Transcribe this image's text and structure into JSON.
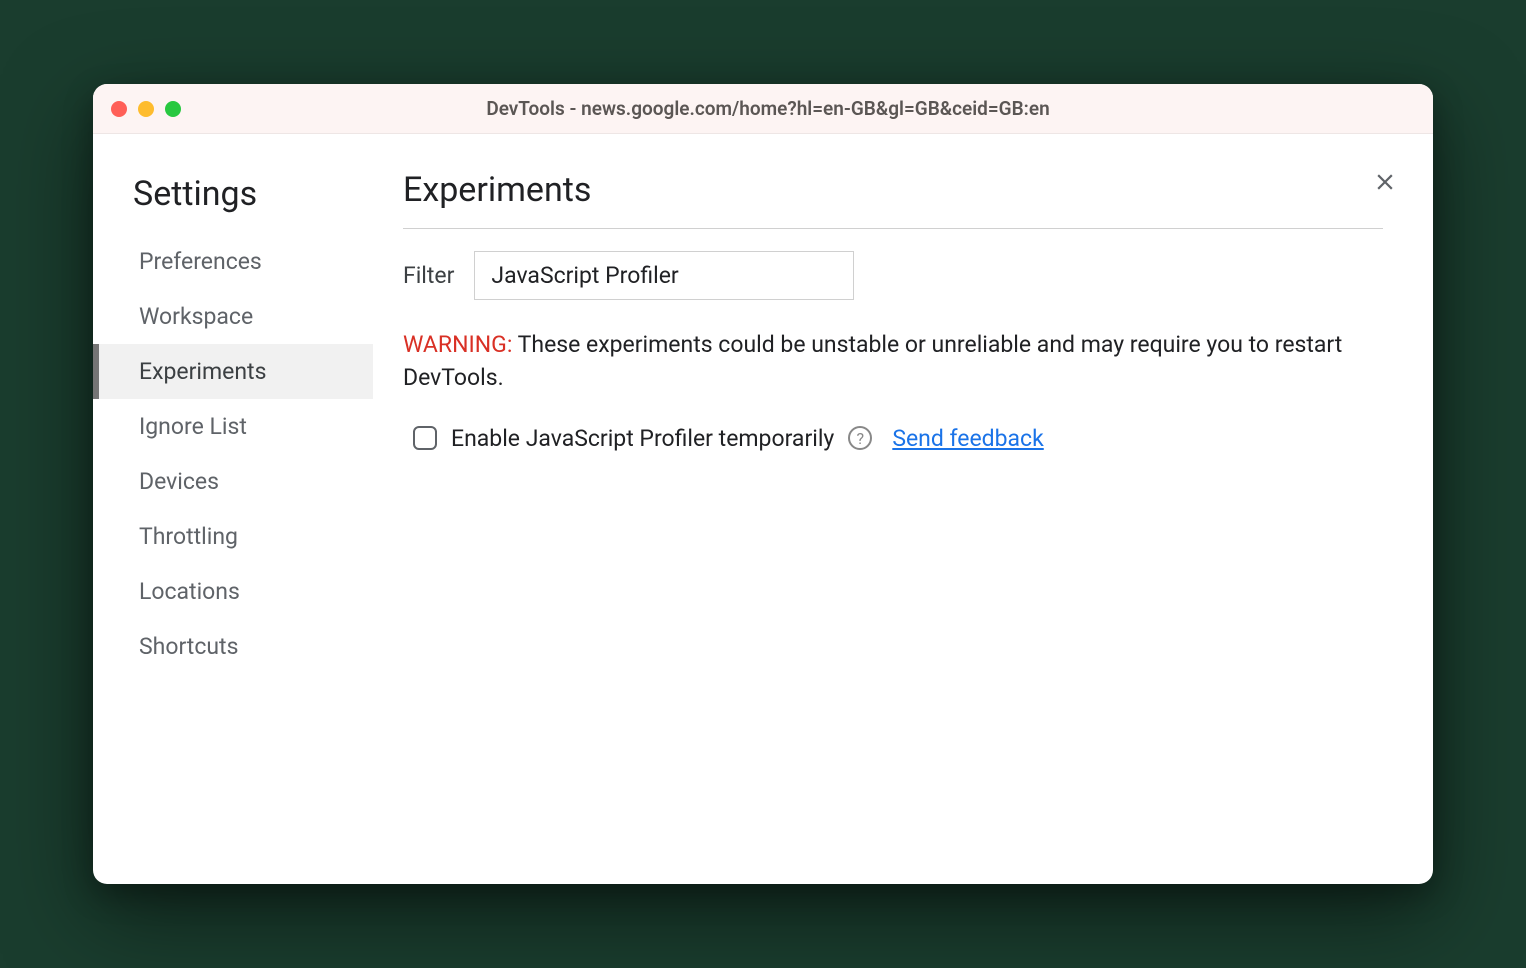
{
  "window": {
    "title": "DevTools - news.google.com/home?hl=en-GB&gl=GB&ceid=GB:en"
  },
  "sidebar": {
    "title": "Settings",
    "items": [
      {
        "label": "Preferences",
        "active": false
      },
      {
        "label": "Workspace",
        "active": false
      },
      {
        "label": "Experiments",
        "active": true
      },
      {
        "label": "Ignore List",
        "active": false
      },
      {
        "label": "Devices",
        "active": false
      },
      {
        "label": "Throttling",
        "active": false
      },
      {
        "label": "Locations",
        "active": false
      },
      {
        "label": "Shortcuts",
        "active": false
      }
    ]
  },
  "main": {
    "title": "Experiments",
    "filter_label": "Filter",
    "filter_value": "JavaScript Profiler",
    "warning_prefix": "WARNING:",
    "warning_text": " These experiments could be unstable or unreliable and may require you to restart DevTools.",
    "experiment": {
      "checked": false,
      "label": "Enable JavaScript Profiler temporarily",
      "help_symbol": "?",
      "feedback_label": "Send feedback"
    }
  }
}
